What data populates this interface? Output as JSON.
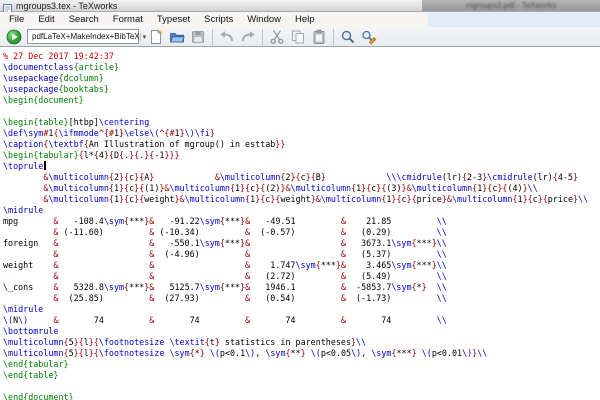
{
  "window": {
    "title": "mgroups3.tex - TeXworks",
    "background_window_title": "mgroups3.pdf - TeXworks"
  },
  "menu": {
    "items": [
      "File",
      "Edit",
      "Search",
      "Format",
      "Typeset",
      "Scripts",
      "Window",
      "Help"
    ]
  },
  "toolbar": {
    "engine": "pdfLaTeX+MakeIndex+BibTeX",
    "buttons": [
      "typeset",
      "new",
      "open",
      "save",
      "undo",
      "redo",
      "cut",
      "copy",
      "paste",
      "find",
      "replace"
    ]
  },
  "editor": {
    "cursor": {
      "line": 10
    },
    "syntax_colors": {
      "comment": "#cc0000",
      "command": "#0000cc",
      "environment": "#007f00",
      "special": "#990000",
      "text": "#000000"
    },
    "lines": [
      "% 27 Dec 2017 19:42:37",
      "\\documentclass{article}",
      "\\usepackage{dcolumn}",
      "\\usepackage{booktabs}",
      "\\begin{document}",
      "",
      "\\begin{table}[htbp]\\centering",
      "\\def\\sym#1{\\ifmmode^{#1}\\else\\(^{#1}\\)\\fi}",
      "\\caption{\\textbf{An Illustration of mgroup() in esttab}}",
      "\\begin{tabular}{l*{4}{D{.}{.}{-1}}}",
      "\\toprule",
      "        &\\multicolumn{2}{c}{A}            &\\multicolumn{2}{c}{B}            \\\\\\cmidrule(lr){2-3}\\cmidrule(lr){4-5}",
      "        &\\multicolumn{1}{c}{(1)}&\\multicolumn{1}{c}{(2)}&\\multicolumn{1}{c}{(3)}&\\multicolumn{1}{c}{(4)}\\\\",
      "        &\\multicolumn{1}{c}{weight}&\\multicolumn{1}{c}{weight}&\\multicolumn{1}{c}{price}&\\multicolumn{1}{c}{price}\\\\",
      "\\midrule",
      "mpg       &   -108.4\\sym{***}&   -91.22\\sym{***}&   -49.51         &    21.85         \\\\",
      "          & (-11.60)         & (-10.34)         &  (-0.57)         &   (0.29)         \\\\",
      "foreign   &                  &   -550.1\\sym{***}&                  &   3673.1\\sym{***}\\\\",
      "          &                  &  (-4.96)         &                  &   (5.37)         \\\\",
      "weight    &                  &                  &    1.747\\sym{***}&    3.465\\sym{***}\\\\",
      "          &                  &                  &   (2.72)         &   (5.49)         \\\\",
      "\\_cons    &   5328.8\\sym{***}&   5125.7\\sym{***}&   1946.1         &  -5853.7\\sym{*}  \\\\",
      "          &  (25.85)         &  (27.93)         &   (0.54)         &  (-1.73)         \\\\",
      "\\midrule",
      "\\(N\\)     &       74         &       74         &       74         &       74         \\\\",
      "\\bottomrule",
      "\\multicolumn{5}{l}{\\footnotesize \\textit{t} statistics in parentheses}\\\\",
      "\\multicolumn{5}{l}{\\footnotesize \\sym{*} \\(p<0.1\\), \\sym{**} \\(p<0.05\\), \\sym{***} \\(p<0.01\\)}\\\\",
      "\\end{tabular}",
      "\\end{table}",
      "",
      "\\end{document}"
    ]
  }
}
